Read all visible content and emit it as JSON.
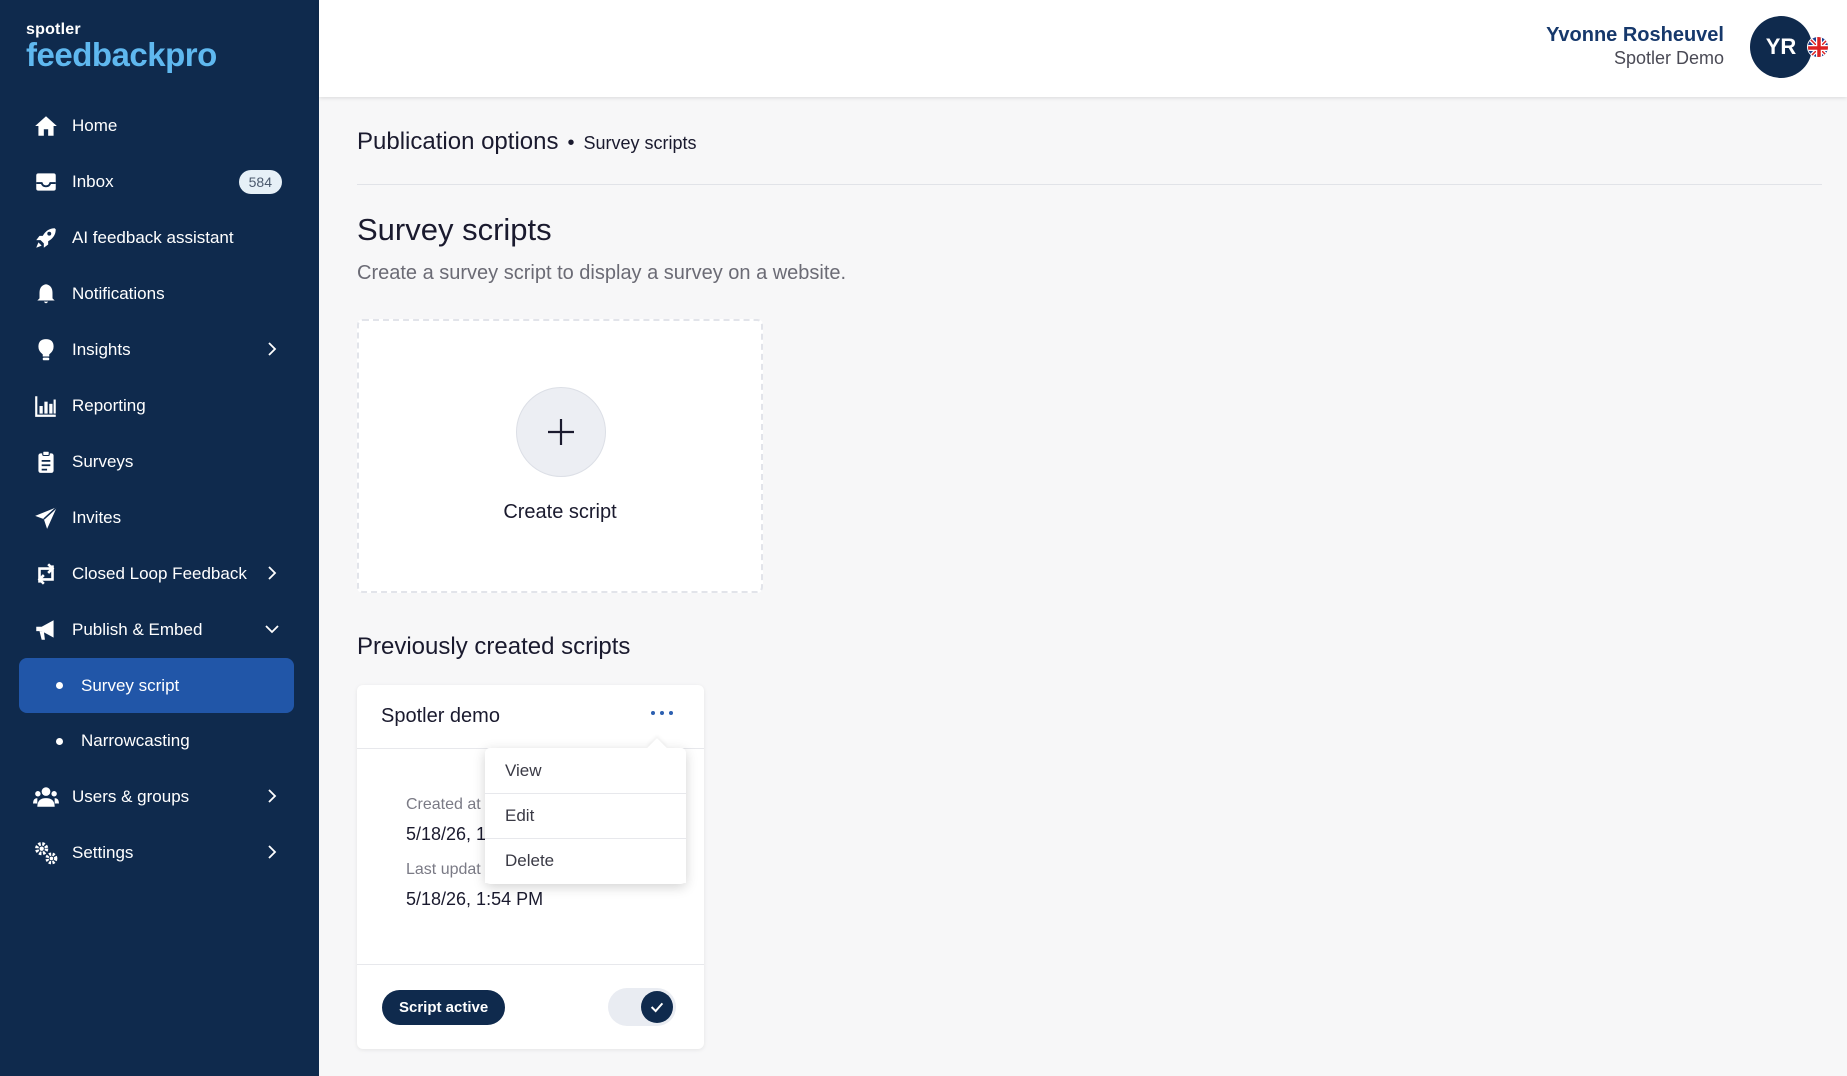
{
  "brand": {
    "top": "spotler",
    "name": "feedbackpro"
  },
  "sidebar": {
    "items": [
      {
        "label": "Home",
        "icon": "home-icon"
      },
      {
        "label": "Inbox",
        "icon": "inbox-icon",
        "badge": "584"
      },
      {
        "label": "AI feedback assistant",
        "icon": "rocket-icon"
      },
      {
        "label": "Notifications",
        "icon": "bell-icon"
      },
      {
        "label": "Insights",
        "icon": "lightbulb-icon"
      },
      {
        "label": "Reporting",
        "icon": "bar-chart-icon"
      },
      {
        "label": "Surveys",
        "icon": "clipboard-icon"
      },
      {
        "label": "Invites",
        "icon": "paper-plane-icon"
      },
      {
        "label": "Closed Loop Feedback",
        "icon": "loop-icon"
      },
      {
        "label": "Publish & Embed",
        "icon": "megaphone-icon"
      },
      {
        "label": "Users & groups",
        "icon": "users-icon"
      },
      {
        "label": "Settings",
        "icon": "gears-icon"
      }
    ],
    "sub_items": [
      {
        "label": "Survey script",
        "active": true
      },
      {
        "label": "Narrowcasting",
        "active": false
      }
    ]
  },
  "header": {
    "user_name": "Yvonne Rosheuvel",
    "org": "Spotler Demo",
    "avatar_initials": "YR",
    "flag_icon": "uk-flag-icon"
  },
  "breadcrumb": {
    "parent": "Publication options",
    "current": "Survey scripts"
  },
  "page": {
    "title": "Survey scripts",
    "subtitle": "Create a survey script to display a survey on a website.",
    "create_label": "Create script",
    "section_title": "Previously created scripts"
  },
  "script_card": {
    "name": "Spotler demo",
    "created_label": "Created at",
    "created_value": "5/18/26, 1",
    "updated_label": "Last updat",
    "updated_value": "5/18/26, 1:54 PM",
    "status": "Script active",
    "toggle_on": true
  },
  "menu": {
    "items": [
      "View",
      "Edit",
      "Delete"
    ]
  },
  "colors": {
    "sidebar_bg": "#0f2a4d",
    "active_item": "#2156a8",
    "brand_accent": "#5fb8ef",
    "header_name": "#16386b"
  }
}
